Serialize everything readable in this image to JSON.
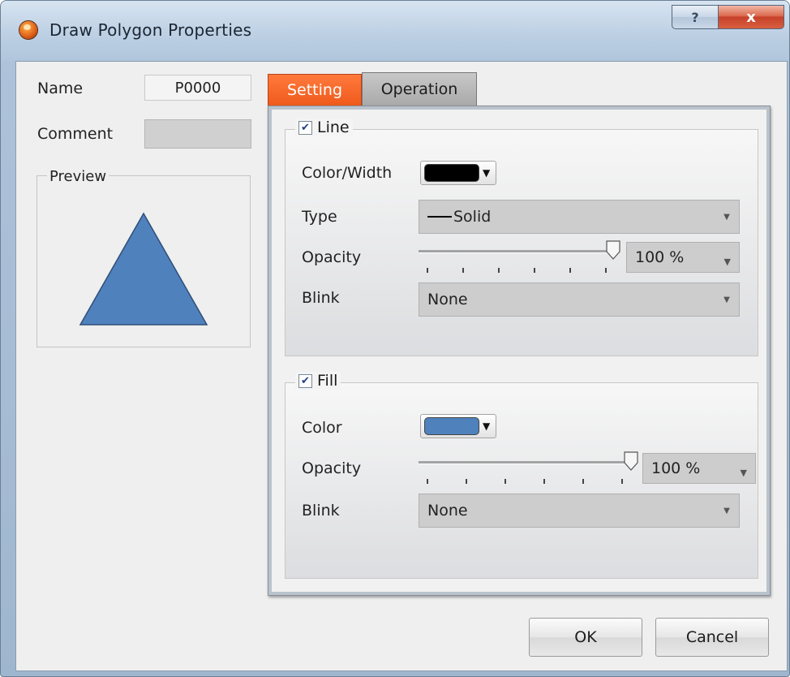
{
  "window": {
    "title": "Draw Polygon Properties"
  },
  "caption_buttons": {
    "help": "?",
    "close": "x"
  },
  "left": {
    "name_label": "Name",
    "name_value": "P0000",
    "comment_label": "Comment",
    "comment_value": "",
    "preview_label": "Preview",
    "preview_fill": "#4f81bd",
    "preview_stroke": "#2f4f78"
  },
  "tabs": [
    {
      "label": "Setting",
      "active": true
    },
    {
      "label": "Operation",
      "active": false
    }
  ],
  "line": {
    "legend": "Line",
    "checked": true,
    "color_width_label": "Color/Width",
    "color": "#000000",
    "type_label": "Type",
    "type_value": "Solid",
    "opacity_label": "Opacity",
    "opacity_value": "100 %",
    "opacity_fraction": 1.0,
    "blink_label": "Blink",
    "blink_value": "None"
  },
  "fill": {
    "legend": "Fill",
    "checked": true,
    "color_label": "Color",
    "color": "#4f81bd",
    "opacity_label": "Opacity",
    "opacity_value": "100 %",
    "opacity_fraction": 1.0,
    "blink_label": "Blink",
    "blink_value": "None"
  },
  "buttons": {
    "ok": "OK",
    "cancel": "Cancel"
  },
  "colors": {
    "active_tab": "#f05a1c",
    "titlebar": "#bdd0e4",
    "close": "#d0523a"
  },
  "icons": {
    "app": "app-flame-icon",
    "check": "checkmark-icon",
    "dropdown": "chevron-down-icon"
  }
}
